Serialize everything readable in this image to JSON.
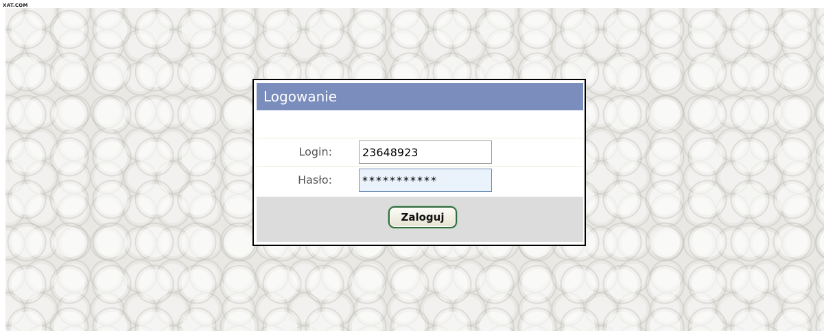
{
  "watermark": "XAT.COM",
  "dialog": {
    "title": "Logowanie",
    "login_label": "Login:",
    "login_value": "23648923",
    "password_label": "Hasło:",
    "password_value": "***********",
    "submit_label": "Zaloguj"
  }
}
